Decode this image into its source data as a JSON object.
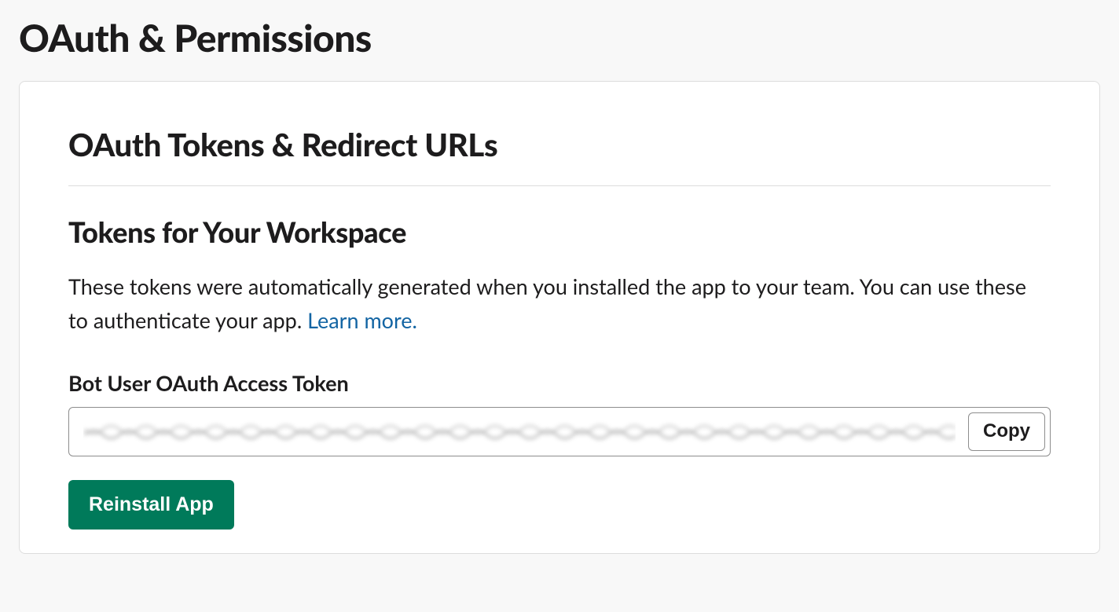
{
  "page": {
    "title": "OAuth & Permissions"
  },
  "section": {
    "title": "OAuth Tokens & Redirect URLs",
    "subtitle": "Tokens for Your Workspace",
    "description_prefix": "These tokens were automatically generated when you installed the app to your team. You can use these to authenticate your app. ",
    "learn_more_label": "Learn more."
  },
  "token": {
    "label": "Bot User OAuth Access Token",
    "value_redacted": true,
    "copy_label": "Copy"
  },
  "actions": {
    "reinstall_label": "Reinstall App"
  },
  "colors": {
    "primary_button": "#007a5a",
    "link": "#1264a3"
  }
}
